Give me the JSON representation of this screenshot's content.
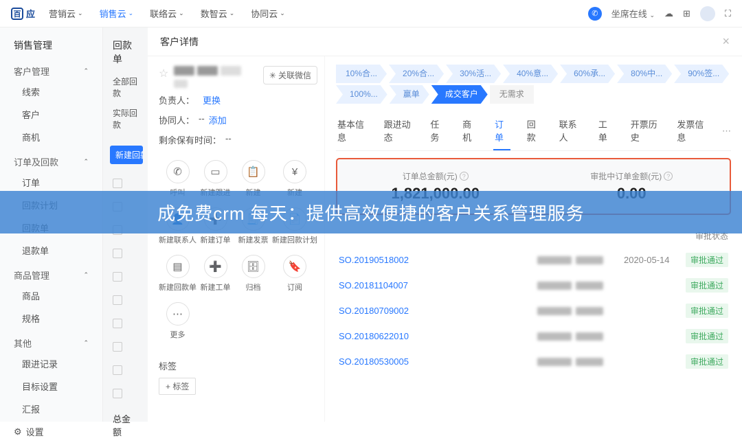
{
  "topnav": {
    "logo": "应",
    "items": [
      "营销云",
      "销售云",
      "联络云",
      "数智云",
      "协同云"
    ],
    "activeIndex": 1,
    "status": "坐席在线"
  },
  "sidebar": {
    "title": "销售管理",
    "groups": [
      {
        "label": "客户管理",
        "items": [
          "线索",
          "客户",
          "商机"
        ]
      },
      {
        "label": "订单及回款",
        "items": [
          "订单",
          "回款计划",
          "回款单",
          "退款单"
        ]
      },
      {
        "label": "商品管理",
        "items": [
          "商品",
          "规格"
        ]
      },
      {
        "label": "其他",
        "items": [
          "跟进记录",
          "目标设置",
          "汇报"
        ]
      }
    ],
    "settings": "设置"
  },
  "mid": {
    "title": "回款单",
    "filter1": "全部回款",
    "filter2": "实际回款",
    "newBtn": "新建回款",
    "total": "总金额"
  },
  "detail": {
    "title": "客户详情",
    "wechat": "关联微信",
    "owner_label": "负责人：",
    "owner_val": "",
    "owner_action": "更换",
    "coop_label": "协同人：",
    "coop_val": "--",
    "coop_action": "添加",
    "remain_label": "剩余保有时间：",
    "remain_val": "--",
    "actions": [
      {
        "icon": "phone",
        "label": "呼叫"
      },
      {
        "icon": "note",
        "label": "新建跟进"
      },
      {
        "icon": "clipboard",
        "label": "新建"
      },
      {
        "icon": "yen",
        "label": "新建"
      },
      {
        "icon": "person",
        "label": "新建联系人"
      },
      {
        "icon": "doc",
        "label": "新建订单"
      },
      {
        "icon": "invoice",
        "label": "新建发票"
      },
      {
        "icon": "plan",
        "label": "新建回款计划"
      },
      {
        "icon": "receipt",
        "label": "新建回款单"
      },
      {
        "icon": "ticket",
        "label": "新建工单"
      },
      {
        "icon": "archive",
        "label": "归档"
      },
      {
        "icon": "bookmark",
        "label": "订阅"
      },
      {
        "icon": "dots",
        "label": "更多"
      }
    ],
    "tags_title": "标签",
    "add_tag": "+ 标签"
  },
  "stages": [
    "10%合...",
    "20%合...",
    "30%活...",
    "40%意...",
    "60%承...",
    "80%中...",
    "90%签...",
    "100%...",
    "赢单",
    "成交客户",
    "无需求"
  ],
  "stage_active": 9,
  "tabs": [
    "基本信息",
    "跟进动态",
    "任务",
    "商机",
    "订单",
    "回款",
    "联系人",
    "工单",
    "开票历史",
    "发票信息"
  ],
  "tab_active": 4,
  "summary": {
    "left_label": "订单总金额(元)",
    "left_val": "1,821,000.00",
    "right_label": "审批中订单金额(元)",
    "right_val": "0.00"
  },
  "table_head": {
    "approve": "审批状态"
  },
  "orders": [
    {
      "id": "SO.20190518002",
      "date": "2020-05-14",
      "status": "审批通过"
    },
    {
      "id": "SO.20181104007",
      "date": "",
      "status": "审批通过"
    },
    {
      "id": "SO.20180709002",
      "date": "",
      "status": "审批通过"
    },
    {
      "id": "SO.20180622010",
      "date": "",
      "status": "审批通过"
    },
    {
      "id": "SO.20180530005",
      "date": "",
      "status": "审批通过"
    }
  ],
  "overlay": "成免费crm 每天：提供高效便捷的客户关系管理服务"
}
